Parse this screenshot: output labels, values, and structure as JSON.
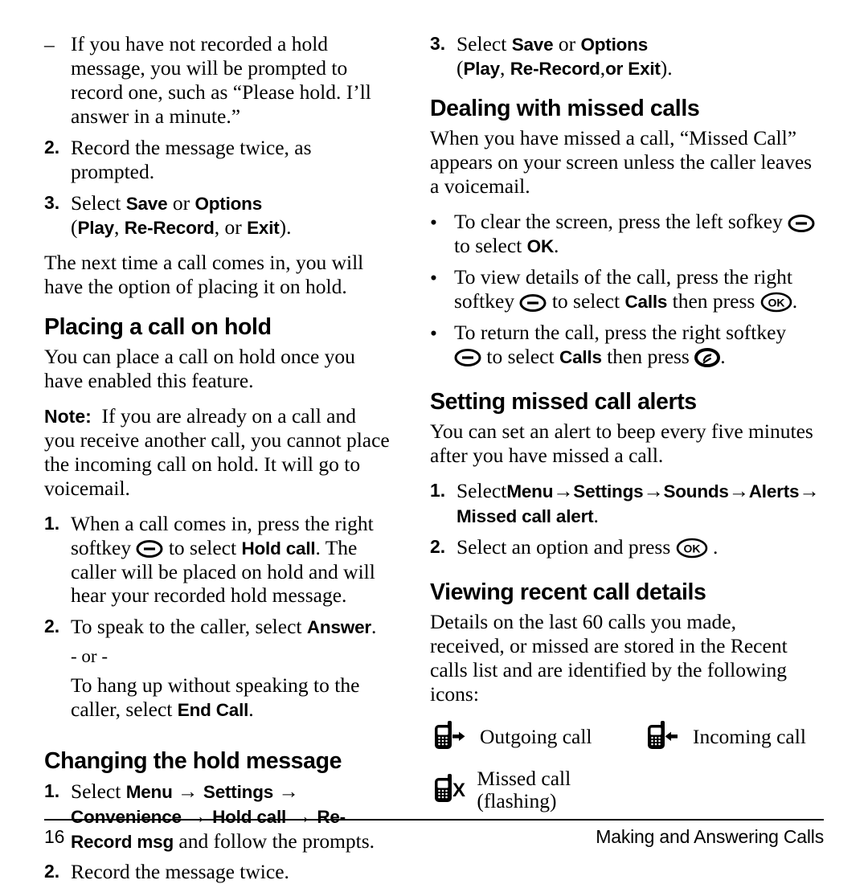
{
  "page": {
    "number": "16",
    "footer_title": "Making and Answering Calls"
  },
  "left_column": {
    "continued_list": {
      "dash_item": {
        "marker": "–",
        "text": "If you have not recorded a hold message, you will be prompted to record one, such as “Please hold. I’ll answer in a minute.”"
      },
      "item2": {
        "marker": "2.",
        "text": "Record the message twice, as prompted."
      },
      "item3": {
        "marker": "3.",
        "lead": "Select ",
        "ui_save": "Save",
        "mid": " or ",
        "ui_options": "Options",
        "paren_open": "(",
        "ui_play": "Play",
        "comma1": ", ",
        "ui_rerecord": "Re-Record",
        "comma2": ", or ",
        "ui_exit": "Exit",
        "paren_close": ")."
      }
    },
    "paragraph_next_time": "The next time a call comes in, you will have the option of placing it on hold.",
    "section_placing": {
      "heading": "Placing a call on hold",
      "intro": "You can place a call on hold once you have enabled this feature.",
      "note_label": "Note:",
      "note_text": "If you are already on a call and you receive another call, you cannot place the incoming call on hold. It will go to voicemail.",
      "step1": {
        "marker": "1.",
        "text_before": "When a call comes in, press the right softkey",
        "icon": "softkey-icon",
        "text_after_icon": " to select ",
        "ui_hold_call": "Hold call",
        "text_tail": ". The caller will be placed on hold and will hear your recorded hold message."
      },
      "step2": {
        "marker": "2.",
        "text_before": "To speak to the caller, select ",
        "ui_answer": "Answer",
        "period": ".",
        "or_divider": "- or -",
        "alt_text_before": "To hang up without speaking to the caller, select ",
        "ui_end_call": "End Call",
        "alt_period": "."
      }
    },
    "section_changing": {
      "heading": "Changing the hold message",
      "step1": {
        "marker": "1.",
        "lead": "Select ",
        "ui_menu": "Menu",
        "arrow": "→",
        "ui_settings": "Settings",
        "ui_convenience": "Convenience",
        "ui_hold_call": "Hold call",
        "ui_rerecord_msg": "Re-Record msg",
        "tail": " and follow the prompts."
      },
      "step2": {
        "marker": "2.",
        "text": "Record the message twice."
      }
    }
  },
  "right_column": {
    "continued_item3": {
      "marker": "3.",
      "lead": "Select ",
      "ui_save": "Save",
      "mid": " or ",
      "ui_options": "Options",
      "paren_open": "(",
      "ui_play": "Play",
      "comma1": ", ",
      "ui_rerecord": "Re-Record",
      "comma2": ",",
      "ui_exit": "or Exit",
      "paren_close": ")."
    },
    "section_missed": {
      "heading": "Dealing with missed calls",
      "intro": "When you have missed a call, “Missed Call” appears on your screen unless the caller leaves a voicemail.",
      "bullets": [
        {
          "marker": "•",
          "text_before": "To clear the screen, press the left sofkey ",
          "icon": "softkey-icon",
          "text_mid": " to select ",
          "ui_ok": "OK",
          "text_tail": "."
        },
        {
          "marker": "•",
          "text_before": "To view details of the call, press the right softkey ",
          "icon": "softkey-icon",
          "text_mid": " to select ",
          "ui_calls": "Calls",
          "text_then": " then press ",
          "icon2": "ok-key-icon",
          "text_tail": "."
        },
        {
          "marker": "•",
          "text_before": "To return the call, press the right softkey ",
          "icon": "softkey-icon",
          "text_mid": " to select ",
          "ui_calls": "Calls",
          "text_then": " then press ",
          "icon2": "send-key-icon",
          "text_tail": "."
        }
      ]
    },
    "section_alerts": {
      "heading": "Setting missed call alerts",
      "intro": "You can set an alert to beep every five minutes after you have missed a call.",
      "step1": {
        "marker": "1.",
        "lead": "Select",
        "ui_menu": "Menu",
        "arrow": "→",
        "ui_settings": "Settings",
        "ui_sounds": "Sounds",
        "ui_alerts": "Alerts",
        "ui_missed_call_alert": "Missed call alert",
        "period": "."
      },
      "step2": {
        "marker": "2.",
        "text_before": "Select an option and press ",
        "icon": "ok-key-icon",
        "text_tail": "."
      }
    },
    "section_viewing": {
      "heading": "Viewing recent call details",
      "intro": "Details on the last 60 calls you made, received, or missed are stored in the Recent calls list and are identified by the following icons:",
      "icons": [
        {
          "icon": "outgoing-call-icon",
          "label": "Outgoing call"
        },
        {
          "icon": "incoming-call-icon",
          "label": "Incoming call"
        },
        {
          "icon": "missed-call-icon",
          "label": "Missed call (flashing)"
        }
      ]
    }
  }
}
